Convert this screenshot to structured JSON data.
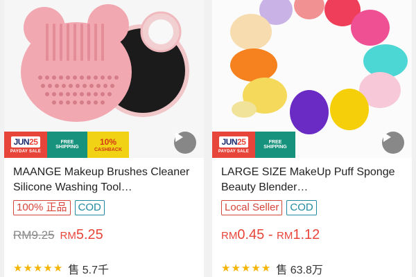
{
  "products": [
    {
      "title": "MAANGE Makeup Brushes Cleaner Silicone Washing Tool…",
      "promo": {
        "event_day": "25",
        "event_month": "JUN",
        "event_sub": "PAYDAY SALE",
        "free_shipping_line1": "FREE",
        "free_shipping_line2": "SHIPPING",
        "cashback_pct": "10%",
        "cashback_label": "CASHBACK"
      },
      "tags": [
        "100% 正品",
        "COD"
      ],
      "original_price": "RM9.25",
      "price_currency": "RM",
      "price_amount": "5.25",
      "rating_stars": 5,
      "sold_label": "售",
      "sold_count": "5.7千"
    },
    {
      "title": "LARGE SIZE MakeUp Puff Sponge Beauty Blender…",
      "promo": {
        "event_day": "25",
        "event_month": "JUN",
        "event_sub": "PAYDAY SALE",
        "free_shipping_line1": "FREE",
        "free_shipping_line2": "SHIPPING"
      },
      "tags": [
        "Local Seller",
        "COD"
      ],
      "price_min_currency": "RM",
      "price_min_amount": "0.45",
      "price_separator": " - ",
      "price_max_currency": "RM",
      "price_max_amount": "1.12",
      "rating_stars": 5,
      "sold_label": "售",
      "sold_count": "63.8万"
    }
  ],
  "colors": {
    "accent_red": "#e8453a",
    "shipping_teal": "#17927c",
    "cashback_yellow": "#f2d214",
    "star_gold": "#f4b400"
  },
  "icons": {
    "play": "play-icon",
    "star": "star-icon"
  }
}
